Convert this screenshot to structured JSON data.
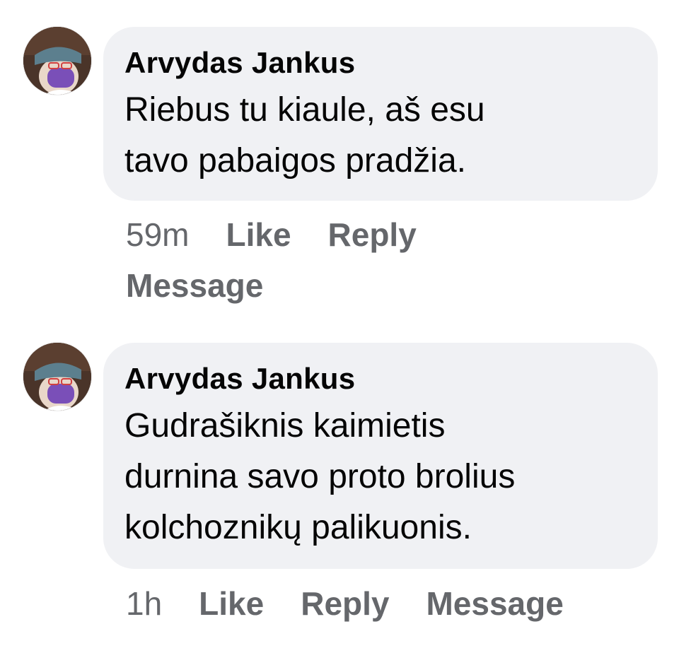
{
  "comments": [
    {
      "author": "Arvydas Jankus",
      "text_lines": [
        "Riebus tu kiaule, aš esu",
        "tavo pabaigos pradžia."
      ],
      "time": "59m",
      "like_label": "Like",
      "reply_label": "Reply",
      "message_label": "Message",
      "avatar_icon": "profile-avatar-icon"
    },
    {
      "author": "Arvydas Jankus",
      "text_lines": [
        "Gudrašiknis kaimietis",
        "durnina savo proto brolius",
        "kolchoznikų palikuonis."
      ],
      "time": "1h",
      "like_label": "Like",
      "reply_label": "Reply",
      "message_label": "Message",
      "avatar_icon": "profile-avatar-icon"
    }
  ],
  "colors": {
    "bubble": "#f0f1f4",
    "text": "#050505",
    "secondary": "#65676b"
  }
}
